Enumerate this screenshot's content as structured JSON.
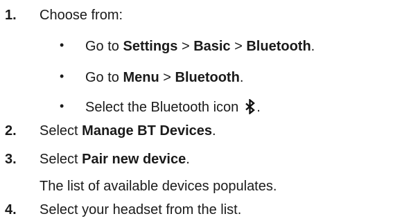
{
  "steps": [
    {
      "number": "1.",
      "text": "Choose from:",
      "options": [
        {
          "prefix": "Go to ",
          "bold1": "Settings",
          "sep1": " > ",
          "bold2": "Basic",
          "sep2": " > ",
          "bold3": "Bluetooth",
          "suffix": "."
        },
        {
          "prefix": "Go to ",
          "bold1": "Menu",
          "sep1": " > ",
          "bold2": "Bluetooth",
          "suffix": "."
        },
        {
          "prefix": "Select the Bluetooth icon",
          "icon": "bluetooth-icon",
          "suffix": "."
        }
      ]
    },
    {
      "number": "2.",
      "prefix": "Select ",
      "bold": "Manage BT Devices",
      "suffix": "."
    },
    {
      "number": "3.",
      "prefix": "Select ",
      "bold": "Pair new device",
      "suffix": ".",
      "note": "The list of available devices populates."
    },
    {
      "number": "4.",
      "text": "Select your headset from the list."
    }
  ],
  "bullet_char": "•"
}
